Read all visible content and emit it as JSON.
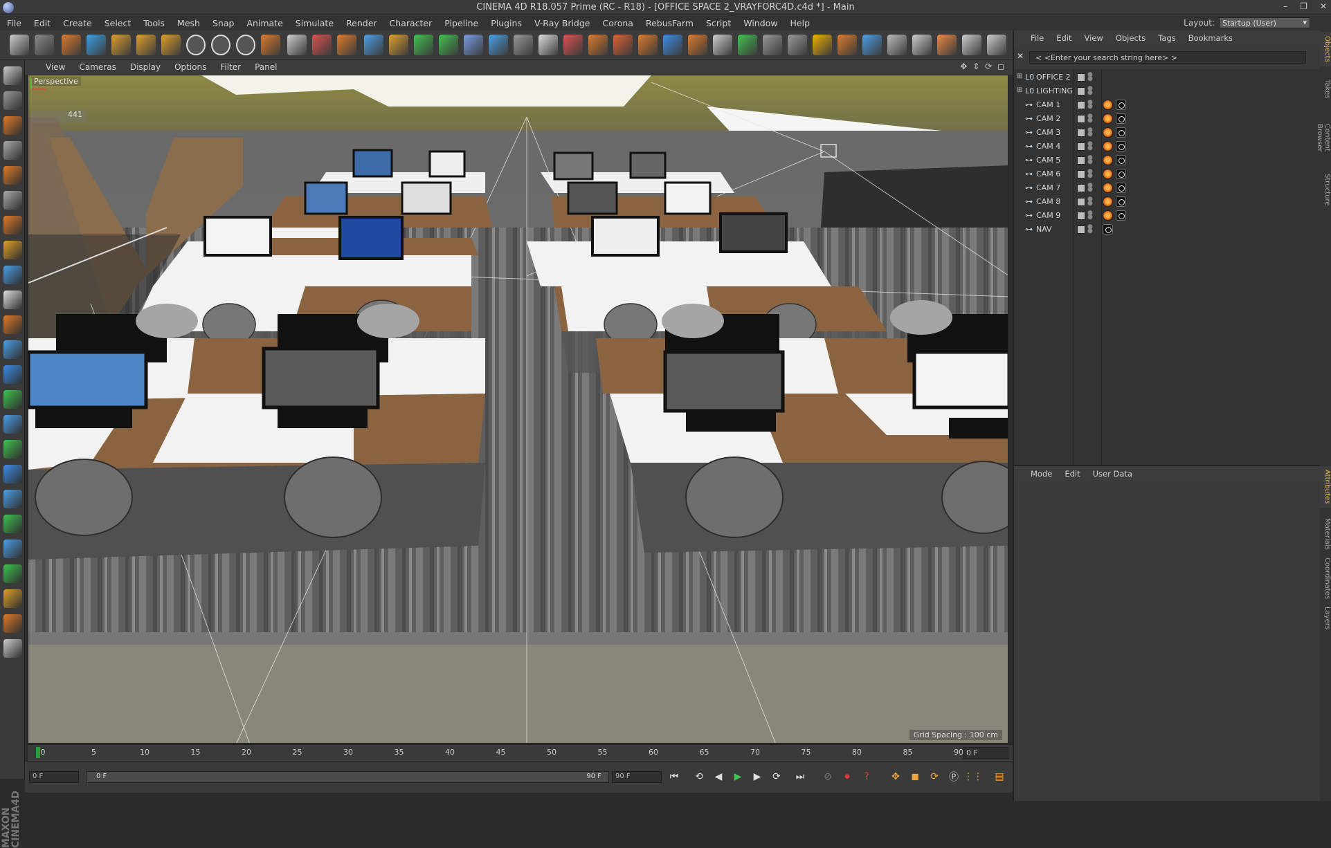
{
  "window": {
    "title": "CINEMA 4D R18.057 Prime (RC - R18) - [OFFICE SPACE 2_VRAYFORC4D.c4d *] - Main",
    "controls": [
      "–",
      "❐",
      "✕"
    ]
  },
  "menubar": {
    "items": [
      "File",
      "Edit",
      "Create",
      "Select",
      "Tools",
      "Mesh",
      "Snap",
      "Animate",
      "Simulate",
      "Render",
      "Character",
      "Pipeline",
      "Plugins",
      "V-Ray Bridge",
      "Corona",
      "RebusFarm",
      "Script",
      "Window",
      "Help"
    ],
    "layout_label": "Layout:",
    "layout_value": "Startup (User)"
  },
  "toolbar": {
    "icons": [
      "undo-icon",
      "redo-icon",
      "live-selection-icon",
      "move-icon",
      "scale-icon",
      "rotate-icon",
      "add-icon",
      "x-axis-icon",
      "y-axis-icon",
      "z-axis-icon",
      "coordinate-system-icon",
      "render-view-icon",
      "render-picture-viewer-icon",
      "edit-render-settings-icon",
      "cube-icon",
      "pen-icon",
      "subdivision-icon",
      "array-icon",
      "deformer-icon",
      "floor-icon",
      "camera-icon",
      "light-icon",
      "vray-camera-icon",
      "vray-light-icon",
      "vray-sky-icon",
      "vray-sun-icon",
      "vray-material-icon",
      "vray-frame-buffer-icon",
      "vray-render-icon",
      "vray-proxy-icon",
      "script-icon",
      "plugin-icon",
      "import-icon",
      "export-icon",
      "rebus-icon",
      "corona-icon",
      "texture-icon",
      "parachute-icon",
      "color-icon",
      "l0-icon"
    ]
  },
  "viewport": {
    "menu": [
      "View",
      "Cameras",
      "Display",
      "Options",
      "Filter",
      "Panel"
    ],
    "label": "Perspective",
    "counter": "441",
    "grid_spacing": "Grid Spacing : 100 cm"
  },
  "timeline": {
    "ticks": [
      "0",
      "5",
      "10",
      "15",
      "20",
      "25",
      "30",
      "35",
      "40",
      "45",
      "50",
      "55",
      "60",
      "65",
      "70",
      "75",
      "80",
      "85",
      "90"
    ],
    "current_frame": "0 F"
  },
  "transport": {
    "start_field": "0 F",
    "range_start": "0 F",
    "range_end": "90 F",
    "end_field": "90 F"
  },
  "object_manager": {
    "menu": [
      "File",
      "Edit",
      "View",
      "Objects",
      "Tags",
      "Bookmarks"
    ],
    "search_placeholder": "< <Enter your search string here> >",
    "objects": [
      {
        "name": "OFFICE 2",
        "type": "null",
        "expandable": true,
        "tags": false
      },
      {
        "name": "LIGHTING",
        "type": "null",
        "expandable": true,
        "tags": false
      },
      {
        "name": "CAM 1",
        "type": "camera",
        "expandable": false,
        "tags": true
      },
      {
        "name": "CAM 2",
        "type": "camera",
        "expandable": false,
        "tags": true
      },
      {
        "name": "CAM 3",
        "type": "camera",
        "expandable": false,
        "tags": true
      },
      {
        "name": "CAM 4",
        "type": "camera",
        "expandable": false,
        "tags": true
      },
      {
        "name": "CAM 5",
        "type": "camera",
        "expandable": false,
        "tags": true
      },
      {
        "name": "CAM 6",
        "type": "camera",
        "expandable": false,
        "tags": true
      },
      {
        "name": "CAM 7",
        "type": "camera",
        "expandable": false,
        "tags": true
      },
      {
        "name": "CAM 8",
        "type": "camera",
        "expandable": false,
        "tags": true
      },
      {
        "name": "CAM 9",
        "type": "camera",
        "expandable": false,
        "tags": true
      },
      {
        "name": "NAV",
        "type": "camera",
        "expandable": false,
        "tags": "single"
      }
    ]
  },
  "attributes": {
    "menu": [
      "Mode",
      "Edit",
      "User Data"
    ]
  },
  "side_tabs": [
    "Objects",
    "Takes",
    "Content Browser",
    "Structure",
    "Attributes",
    "Materials",
    "Coordinates",
    "Layers"
  ],
  "brand": "MAXON CINEMA4D",
  "colors": {
    "accent": "#e5b84f",
    "playhead": "#2d9a3c",
    "wood": "#8a6440",
    "desk_white": "#f2f2f2",
    "monitor_blue": "#3d6aa8"
  }
}
